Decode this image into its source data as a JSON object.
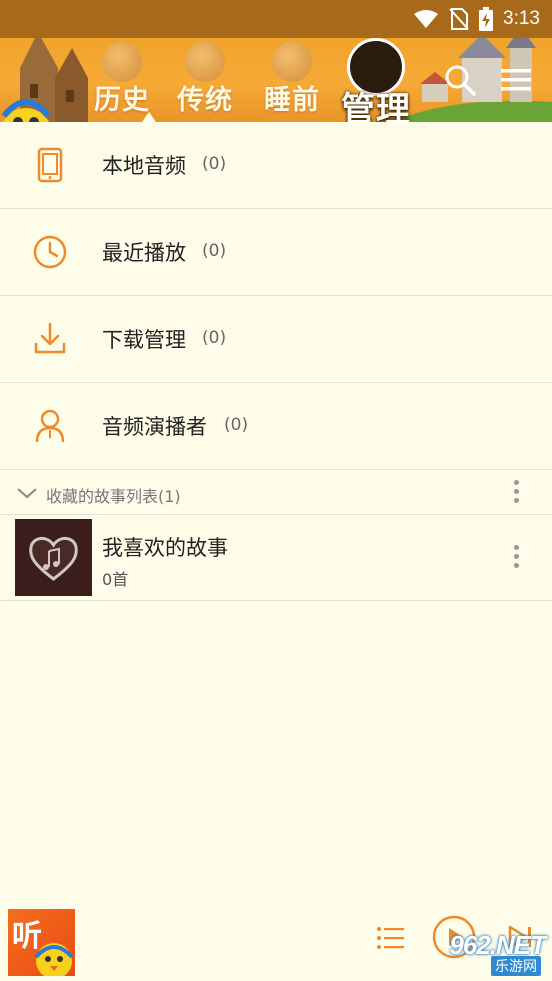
{
  "status_bar": {
    "time": "3:13"
  },
  "tabs": [
    {
      "label": "历史",
      "active": false
    },
    {
      "label": "传统",
      "active": false
    },
    {
      "label": "睡前",
      "active": false
    },
    {
      "label": "管理",
      "active": true
    }
  ],
  "menu": [
    {
      "label": "本地音频",
      "count": "(0)",
      "icon": "tablet-icon"
    },
    {
      "label": "最近播放",
      "count": "(0)",
      "icon": "clock-icon"
    },
    {
      "label": "下载管理",
      "count": "(0)",
      "icon": "download-icon"
    },
    {
      "label": "音频演播者",
      "count": "(0)",
      "icon": "person-icon"
    }
  ],
  "favorites": {
    "section_label": "收藏的故事列表(1)",
    "playlists": [
      {
        "title": "我喜欢的故事",
        "subtitle": "0首"
      }
    ]
  },
  "player": {
    "art_text": "听"
  },
  "watermark": {
    "main": "962.NET",
    "sub": "乐游网"
  },
  "colors": {
    "accent": "#ee8a2c",
    "background": "#fefde9",
    "header": "#f6a935"
  }
}
